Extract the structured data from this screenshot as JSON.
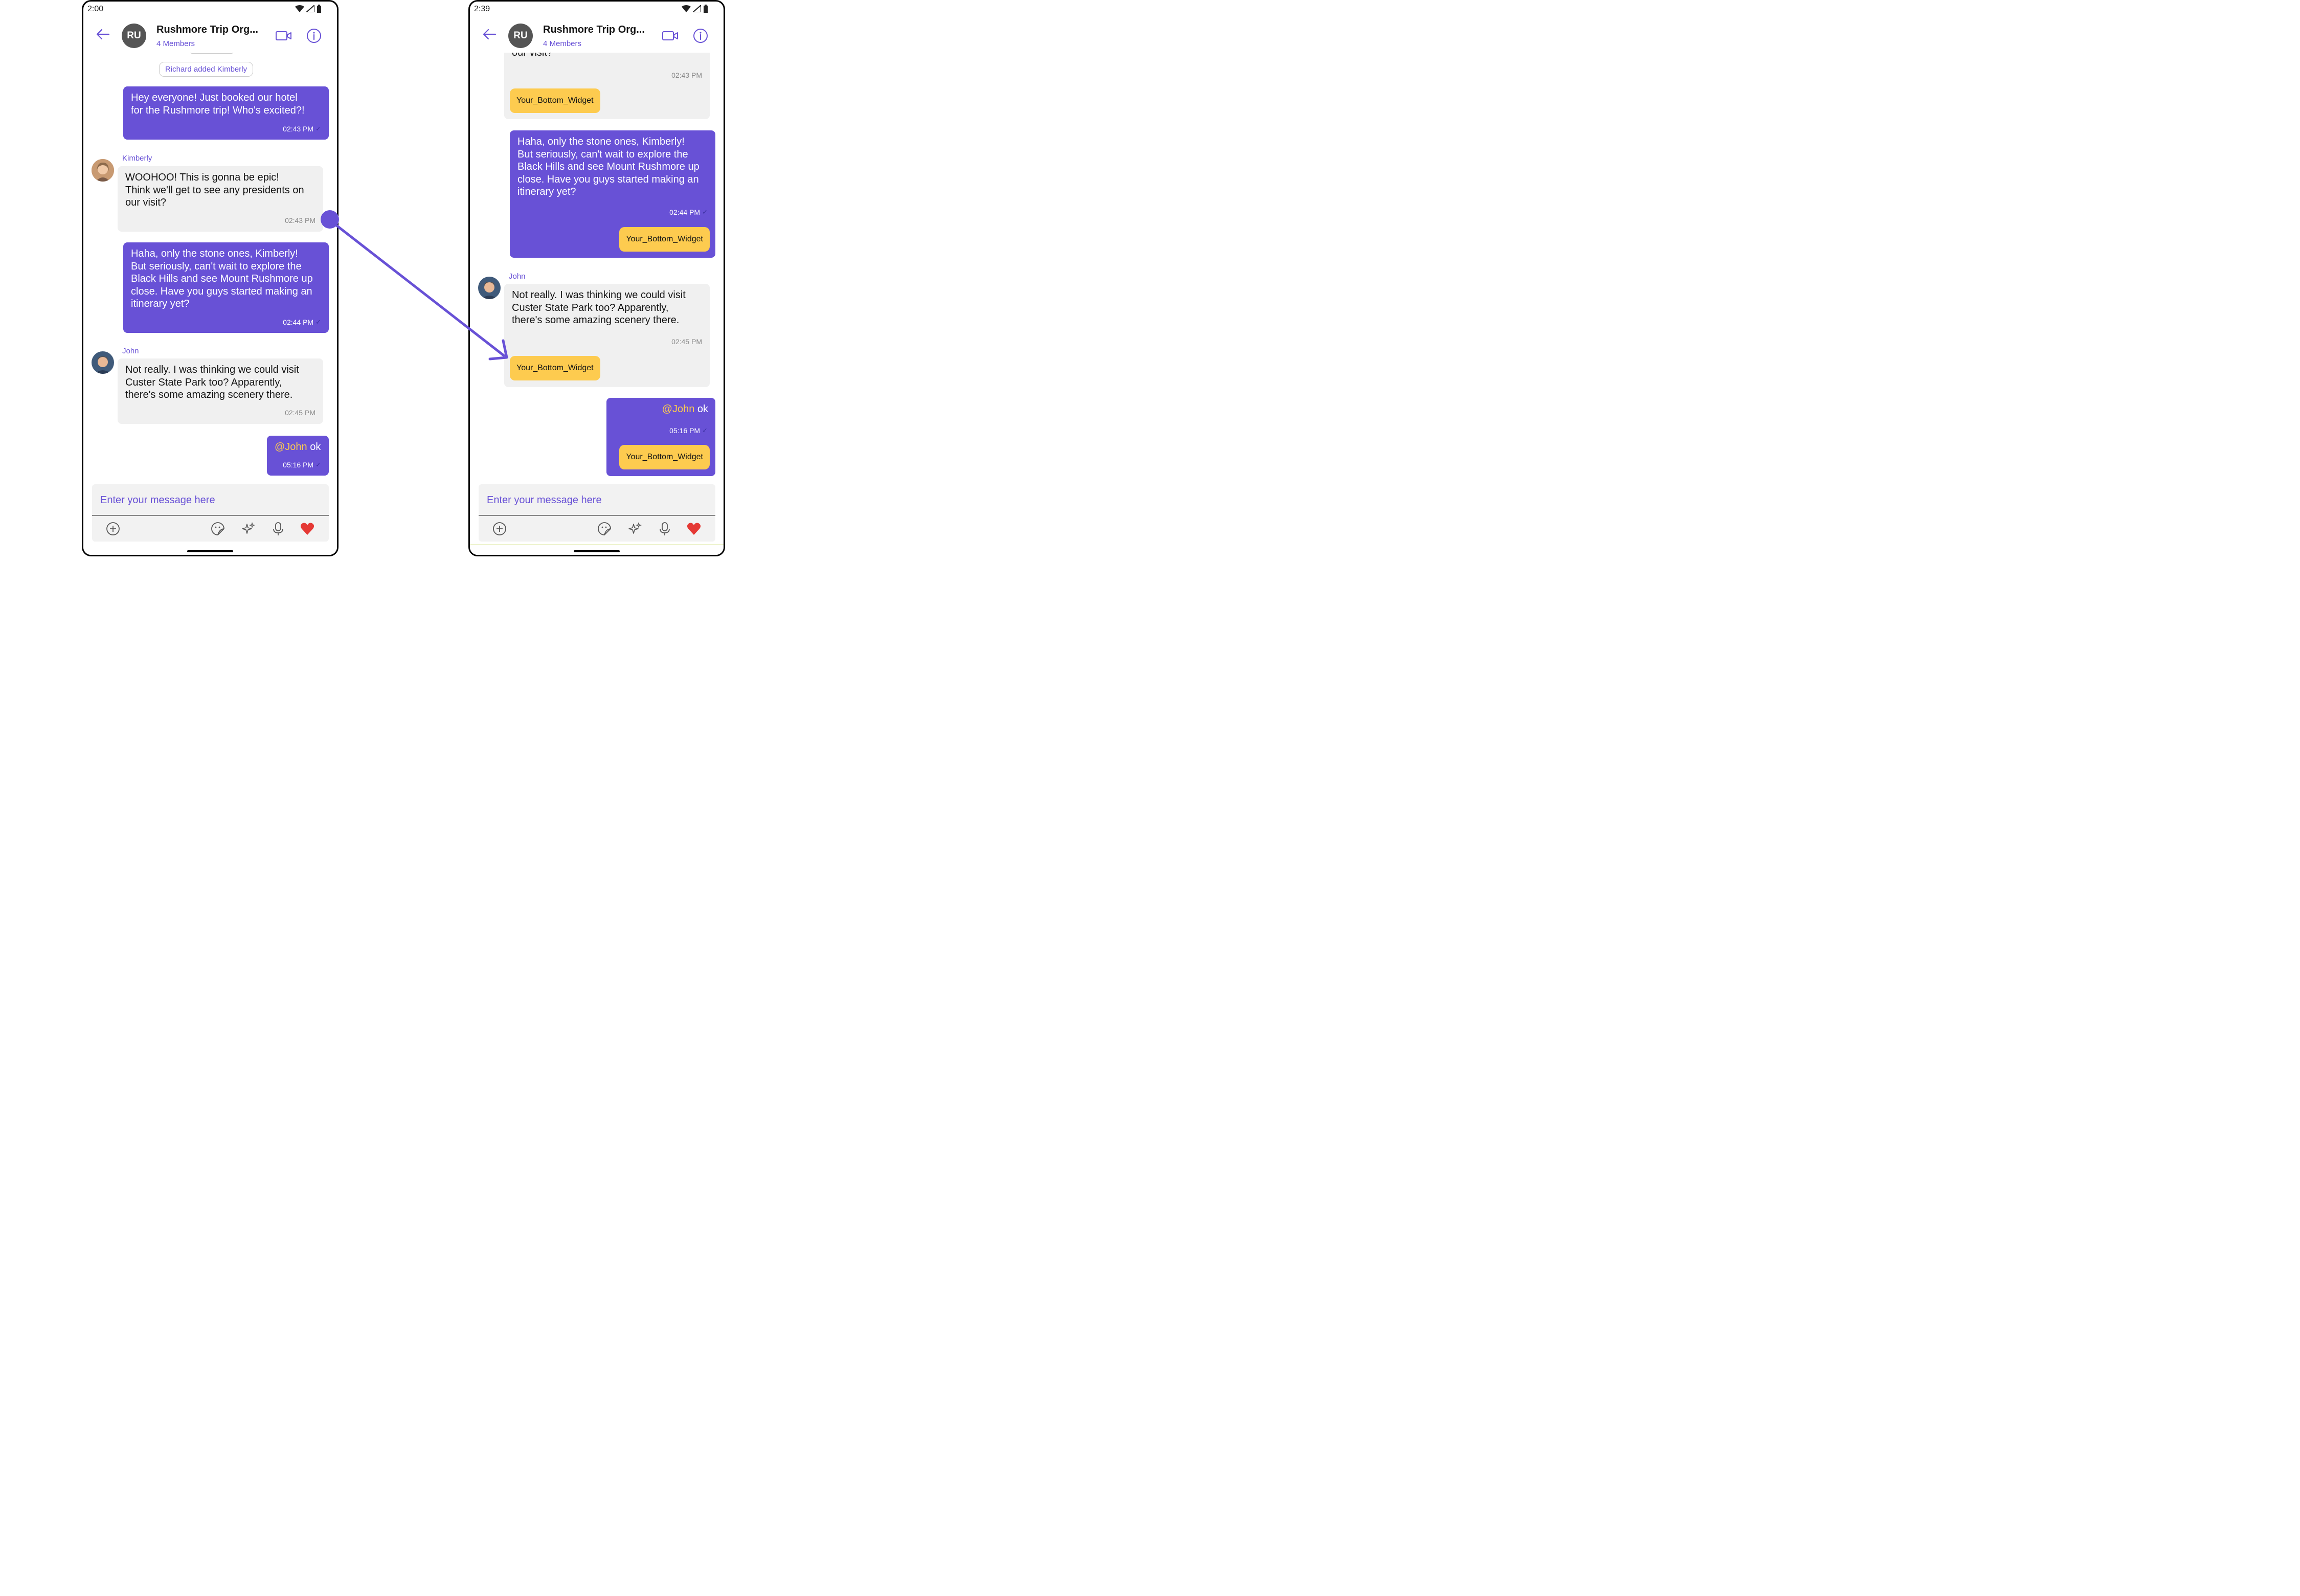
{
  "left": {
    "status_time": "2:00",
    "header": {
      "avatar": "RU",
      "title": "Rushmore Trip Org...",
      "subtitle": "4 Members"
    },
    "action": "Richard added Kimberly",
    "msg1": {
      "text": "Hey everyone!  Just booked our hotel\nfor the Rushmore trip!  Who's excited?!",
      "time": "02:43 PM"
    },
    "msg2": {
      "sender": "Kimberly",
      "text": "WOOHOO!  This is gonna be epic!\nThink we'll get to see any presidents on\nour visit?",
      "time": "02:43 PM"
    },
    "msg3": {
      "text": " Haha, only the stone ones, Kimberly!\nBut seriously, can't wait to explore the\nBlack Hills and see Mount Rushmore up\nclose.  Have you guys started making an\nitinerary yet?",
      "time": "02:44 PM"
    },
    "msg4": {
      "sender": "John",
      "text": "Not really.  I was thinking we could visit\nCuster State Park too?  Apparently,\nthere's some amazing scenery there.",
      "time": "02:45 PM"
    },
    "msg5": {
      "mention": "@John",
      "text": " ok",
      "time": "05:16 PM"
    },
    "composer_placeholder": "Enter your message here"
  },
  "right": {
    "status_time": "2:39",
    "header": {
      "avatar": "RU",
      "title": "Rushmore Trip Org...",
      "subtitle": "4 Members"
    },
    "msg0": {
      "text": "our visit?",
      "time": "02:43 PM",
      "widget": "Your_Bottom_Widget"
    },
    "msg1": {
      "text": " Haha, only the stone ones, Kimberly!\nBut seriously, can't wait to explore the\nBlack Hills and see Mount Rushmore up\nclose.  Have you guys started making an\nitinerary yet?",
      "time": "02:44 PM",
      "widget": "Your_Bottom_Widget"
    },
    "msg2": {
      "sender": "John",
      "text": "Not really.  I was thinking we could visit\nCuster State Park too?  Apparently,\nthere's some amazing scenery there.",
      "time": "02:45 PM",
      "widget": "Your_Bottom_Widget"
    },
    "msg3": {
      "mention": "@John",
      "text": " ok",
      "time": "05:16 PM",
      "widget": "Your_Bottom_Widget"
    },
    "composer_placeholder": "Enter your message here"
  },
  "colors": {
    "primary": "#6851D6",
    "widget": "#FDCB4F",
    "incoming": "#F0F0F0",
    "heart": "#E53935"
  },
  "icons": [
    "back-arrow-icon",
    "video-call-icon",
    "info-icon",
    "add-icon",
    "sticker-icon",
    "ai-sparkle-icon",
    "microphone-icon",
    "heart-icon",
    "wifi-icon",
    "signal-icon",
    "battery-icon"
  ]
}
